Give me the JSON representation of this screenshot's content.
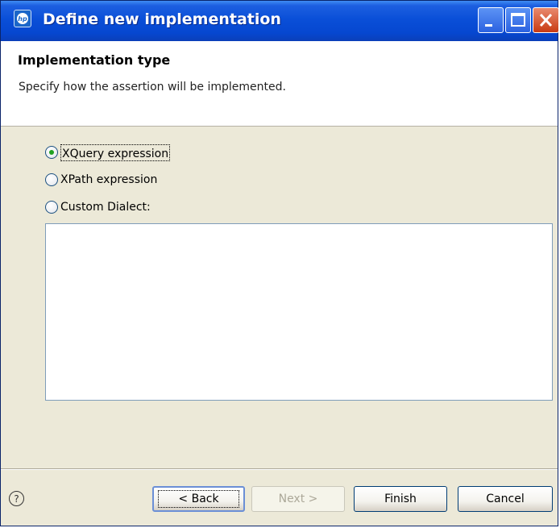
{
  "window": {
    "title": "Define new implementation",
    "app_icon_text": "hp"
  },
  "banner": {
    "title": "Implementation type",
    "description": "Specify how the assertion will be implemented."
  },
  "options": [
    {
      "label": "XQuery expression",
      "selected": true
    },
    {
      "label": "XPath expression",
      "selected": false
    },
    {
      "label": "Custom Dialect:",
      "selected": false
    }
  ],
  "custom_dialect_text": "",
  "footer": {
    "help_label": "?",
    "back_label": "< Back",
    "next_label": "Next >",
    "finish_label": "Finish",
    "cancel_label": "Cancel"
  },
  "colors": {
    "titlebar": "#0a4fd8",
    "dialog_bg": "#ece9d8",
    "radio_selected": "#21a121",
    "close_button": "#c83a12"
  }
}
